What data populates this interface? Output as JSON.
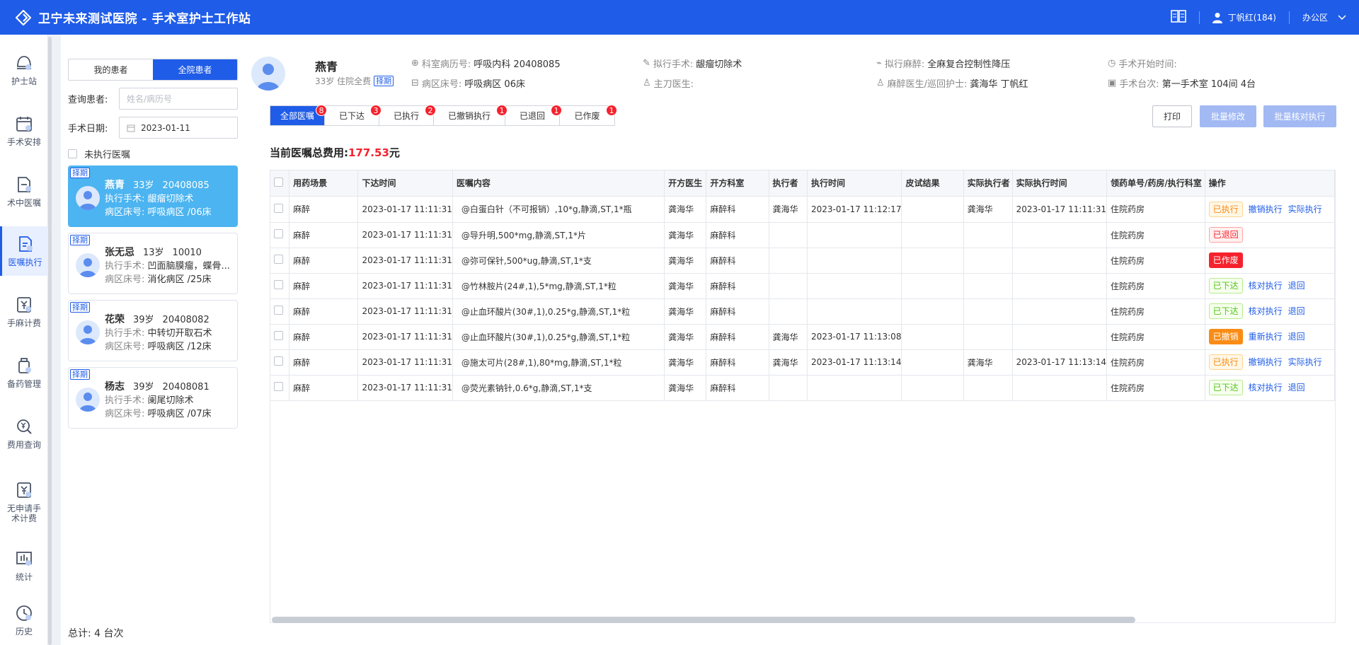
{
  "app": {
    "title": "卫宁未来测试医院 - 手术室护士工作站",
    "user": "丁帆红(184)",
    "office": "办公区"
  },
  "nav": [
    {
      "label": "护士站",
      "icon": "nurse-cap-icon"
    },
    {
      "label": "手术安排",
      "icon": "calendar-icon"
    },
    {
      "label": "术中医嘱",
      "icon": "document-icon"
    },
    {
      "label": "医嘱执行",
      "icon": "edit-document-icon"
    },
    {
      "label": "手麻计费",
      "icon": "yuan-icon"
    },
    {
      "label": "备药管理",
      "icon": "medicine-bottle-icon"
    },
    {
      "label": "费用查询",
      "icon": "fee-search-icon"
    },
    {
      "label": "无申请手术计费",
      "icon": "yuan-doc-icon"
    },
    {
      "label": "统计",
      "icon": "chart-icon"
    },
    {
      "label": "历史",
      "icon": "clock-icon"
    }
  ],
  "left": {
    "tab_mine": "我的患者",
    "tab_all": "全院患者",
    "query_label": "查询患者:",
    "query_placeholder": "姓名/病历号",
    "date_label": "手术日期:",
    "date_value": "2023-01-11",
    "unexec_label": "未执行医嘱",
    "total": "总计:  4 台次",
    "patients": [
      {
        "tag": "择期",
        "name": "燕青",
        "age": "33岁",
        "id": "20408085",
        "surgery_label": "执行手术:",
        "surgery": "龈瘤切除术",
        "bed_label": "病区床号:",
        "bed": "呼吸病区 /06床"
      },
      {
        "tag": "择期",
        "name": "张无忌",
        "age": "13岁",
        "id": "10010",
        "surgery_label": "执行手术:",
        "surgery": "凹面脑膜瘤，蝶骨...",
        "bed_label": "病区床号:",
        "bed": "消化病区 /25床"
      },
      {
        "tag": "择期",
        "name": "花荣",
        "age": "39岁",
        "id": "20408082",
        "surgery_label": "执行手术:",
        "surgery": "中转切开取石术",
        "bed_label": "病区床号:",
        "bed": "呼吸病区 /12床"
      },
      {
        "tag": "择期",
        "name": "杨志",
        "age": "39岁",
        "id": "20408081",
        "surgery_label": "执行手术:",
        "surgery": "阑尾切除术",
        "bed_label": "病区床号:",
        "bed": "呼吸病区 /07床"
      }
    ]
  },
  "header": {
    "name": "燕青",
    "sub": "33岁 住院全费",
    "tag": "择期",
    "record_label": "科室病历号:",
    "record": "呼吸内科 20408085",
    "bed_label": "病区床号:",
    "bed": "呼吸病区 06床",
    "surgery_label": "拟行手术:",
    "surgery": "龈瘤切除术",
    "surgeon_label": "主刀医生:",
    "surgeon": "",
    "anes_label": "拟行麻醉:",
    "anes": "全麻复合控制性降压",
    "anes_doc_label": "麻醉医生/巡回护士:",
    "anes_doc": "龚海华 丁帆红",
    "start_label": "手术开始时间:",
    "start": "",
    "room_label": "手术台次:",
    "room": "第一手术室 104间 4台"
  },
  "tabs": [
    {
      "label": "全部医嘱",
      "count": "8"
    },
    {
      "label": "已下达",
      "count": "3"
    },
    {
      "label": "已执行",
      "count": "2"
    },
    {
      "label": "已撤销执行",
      "count": "1"
    },
    {
      "label": "已退回",
      "count": "1"
    },
    {
      "label": "已作废",
      "count": "1"
    }
  ],
  "buttons": {
    "print": "打印",
    "batch_edit": "批量修改",
    "batch_exec": "批量核对执行"
  },
  "fee": {
    "label": "当前医嘱总费用:",
    "amount": "177.53",
    "unit": "元"
  },
  "table": {
    "columns": [
      "用药场景",
      "下达时间",
      "医嘱内容",
      "开方医生",
      "开方科室",
      "执行者",
      "执行时间",
      "皮试结果",
      "实际执行者",
      "实际执行时间",
      "领药单号/药房/执行科室",
      "操作"
    ],
    "rows": [
      {
        "scene": "麻醉",
        "time": "2023-01-17 11:11:31",
        "content": "@白蛋白针（不可报销）,10*g,静滴,ST,1*瓶",
        "doctor": "龚海华",
        "dept": "麻醉科",
        "executor": "龚海华",
        "exec_time": "2023-01-17 11:12:17",
        "skin": "",
        "actual": "龚海华",
        "actual_time": "2023-01-17 11:11:31",
        "pharmacy": "住院药房",
        "status": "已执行",
        "status_type": "exec",
        "ops": [
          "撤销执行",
          "实际执行"
        ]
      },
      {
        "scene": "麻醉",
        "time": "2023-01-17 11:11:31",
        "content": "@导升明,500*mg,静滴,ST,1*片",
        "doctor": "龚海华",
        "dept": "麻醉科",
        "executor": "",
        "exec_time": "",
        "skin": "",
        "actual": "",
        "actual_time": "",
        "pharmacy": "住院药房",
        "status": "已退回",
        "status_type": "ret",
        "ops": []
      },
      {
        "scene": "麻醉",
        "time": "2023-01-17 11:11:31",
        "content": "@弥可保针,500*ug,静滴,ST,1*支",
        "doctor": "龚海华",
        "dept": "麻醉科",
        "executor": "",
        "exec_time": "",
        "skin": "",
        "actual": "",
        "actual_time": "",
        "pharmacy": "住院药房",
        "status": "已作废",
        "status_type": "void",
        "ops": []
      },
      {
        "scene": "麻醉",
        "time": "2023-01-17 11:11:31",
        "content": "@竹林胺片(24#,1),5*mg,静滴,ST,1*粒",
        "doctor": "龚海华",
        "dept": "麻醉科",
        "executor": "",
        "exec_time": "",
        "skin": "",
        "actual": "",
        "actual_time": "",
        "pharmacy": "住院药房",
        "status": "已下达",
        "status_type": "iss",
        "ops": [
          "核对执行",
          "退回"
        ]
      },
      {
        "scene": "麻醉",
        "time": "2023-01-17 11:11:31",
        "content": "@止血环酸片(30#,1),0.25*g,静滴,ST,1*粒",
        "doctor": "龚海华",
        "dept": "麻醉科",
        "executor": "",
        "exec_time": "",
        "skin": "",
        "actual": "",
        "actual_time": "",
        "pharmacy": "住院药房",
        "status": "已下达",
        "status_type": "iss",
        "ops": [
          "核对执行",
          "退回"
        ]
      },
      {
        "scene": "麻醉",
        "time": "2023-01-17 11:11:31",
        "content": "@止血环酸片(30#,1),0.25*g,静滴,ST,1*粒",
        "doctor": "龚海华",
        "dept": "麻醉科",
        "executor": "龚海华",
        "exec_time": "2023-01-17 11:13:08",
        "skin": "",
        "actual": "",
        "actual_time": "",
        "pharmacy": "住院药房",
        "status": "已撤销",
        "status_type": "canc",
        "ops": [
          "重新执行",
          "退回"
        ]
      },
      {
        "scene": "麻醉",
        "time": "2023-01-17 11:11:31",
        "content": "@施太可片(28#,1),80*mg,静滴,ST,1*粒",
        "doctor": "龚海华",
        "dept": "麻醉科",
        "executor": "龚海华",
        "exec_time": "2023-01-17 11:13:14",
        "skin": "",
        "actual": "龚海华",
        "actual_time": "2023-01-17 11:13:14",
        "pharmacy": "住院药房",
        "status": "已执行",
        "status_type": "exec",
        "ops": [
          "撤销执行",
          "实际执行"
        ]
      },
      {
        "scene": "麻醉",
        "time": "2023-01-17 11:11:31",
        "content": "@荧光素钠针,0.6*g,静滴,ST,1*支",
        "doctor": "龚海华",
        "dept": "麻醉科",
        "executor": "",
        "exec_time": "",
        "skin": "",
        "actual": "",
        "actual_time": "",
        "pharmacy": "住院药房",
        "status": "已下达",
        "status_type": "iss",
        "ops": [
          "核对执行",
          "退回"
        ]
      }
    ]
  }
}
